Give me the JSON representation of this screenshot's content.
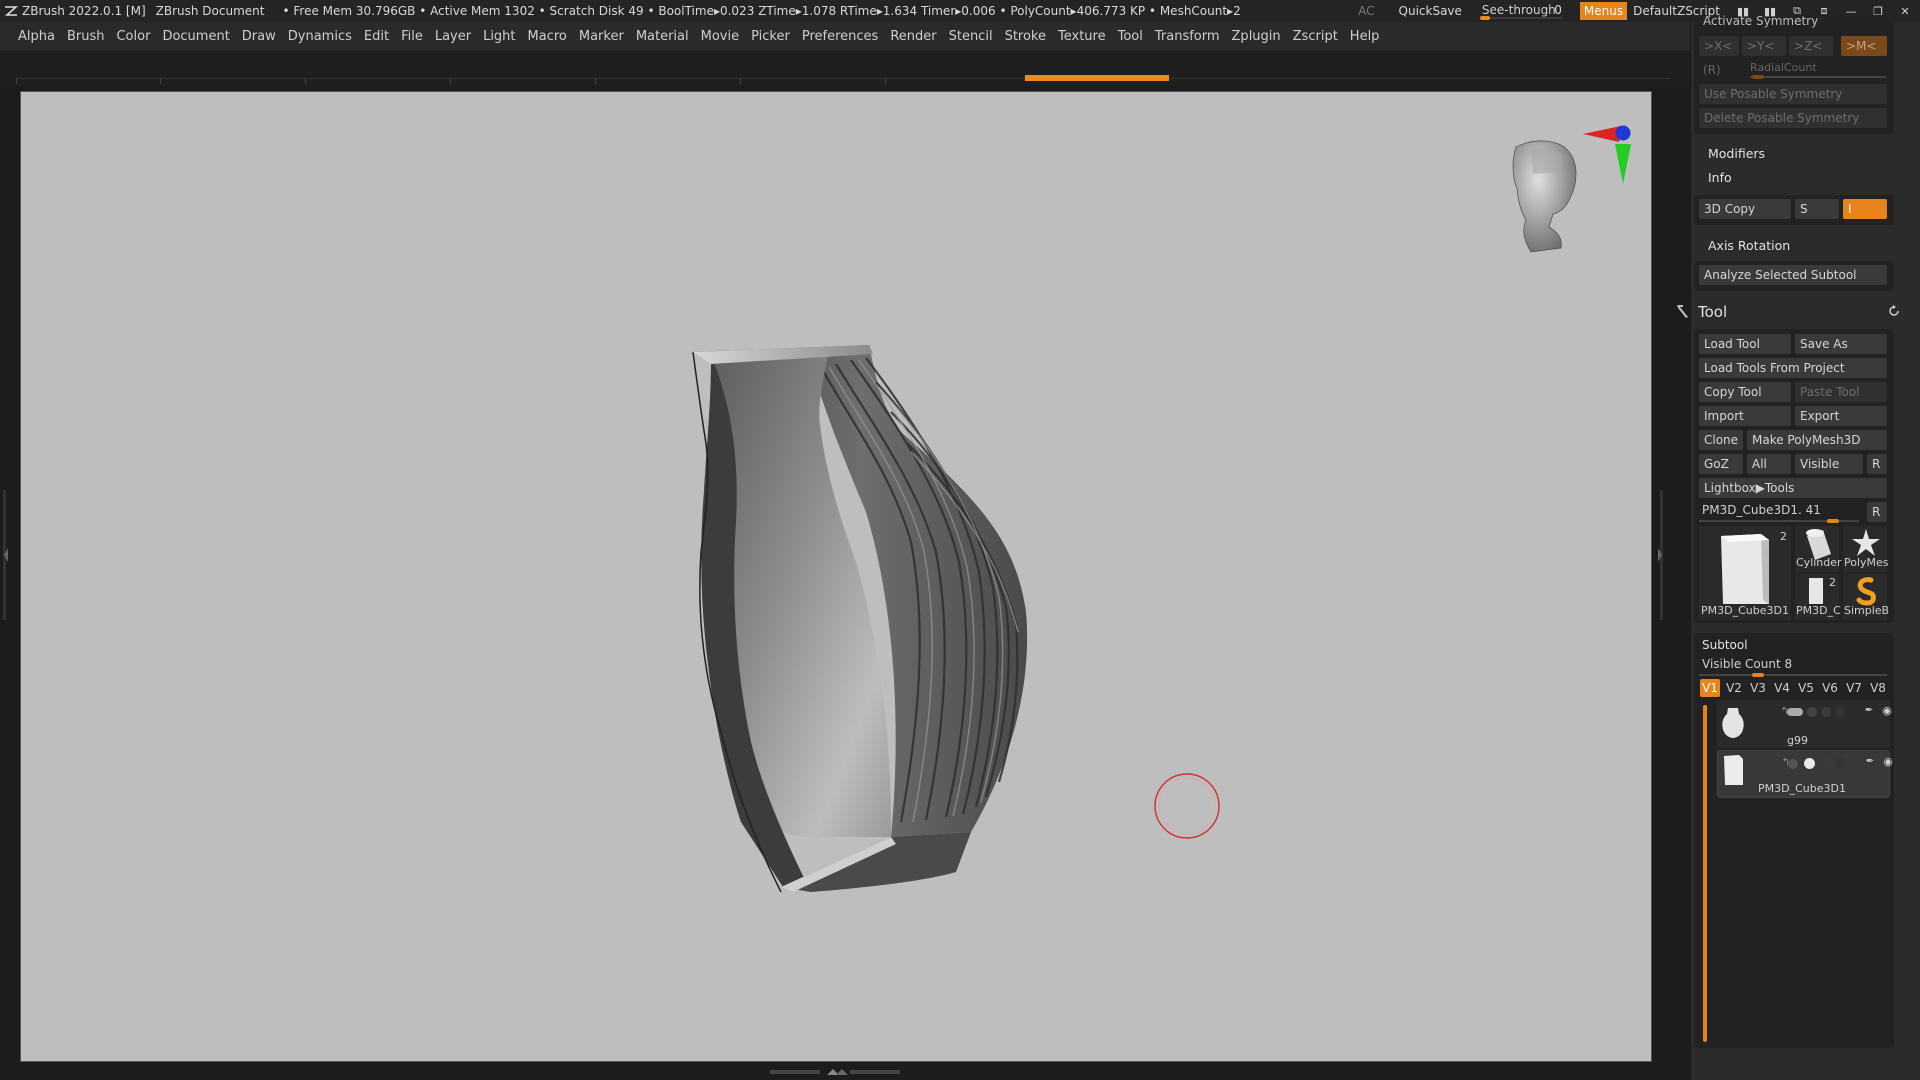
{
  "titlebar": {
    "app": "ZBrush 2022.0.1 [M]",
    "document": "ZBrush Document",
    "stats": "• Free Mem 30.796GB • Active Mem 1302 • Scratch Disk 49 •  BoolTime▸0.023 ZTime▸1.078 RTime▸1.634 Timer▸0.006 • PolyCount▸406.773 KP  • MeshCount▸2",
    "ac": "AC",
    "quicksave": "QuickSave",
    "see_through_label": "See-through",
    "see_through_value": "0",
    "menus": "Menus",
    "script": "DefaultZScript"
  },
  "menubar": [
    "Alpha",
    "Brush",
    "Color",
    "Document",
    "Draw",
    "Dynamics",
    "Edit",
    "File",
    "Layer",
    "Light",
    "Macro",
    "Marker",
    "Material",
    "Movie",
    "Picker",
    "Preferences",
    "Render",
    "Stencil",
    "Stroke",
    "Texture",
    "Tool",
    "Transform",
    "Zplugin",
    "Zscript",
    "Help"
  ],
  "symmetry": {
    "activate": "Activate Symmetry",
    "x": ">X<",
    "y": ">Y<",
    "z": ">Z<",
    "m": ">M<",
    "r": "(R)",
    "radial": "RadialCount",
    "use_posable": "Use Posable Symmetry",
    "delete_posable": "Delete Posable Symmetry"
  },
  "transform": {
    "modifiers": "Modifiers",
    "info": "Info",
    "copy3d": "3D Copy",
    "s": "S",
    "s_value": "I",
    "axis_rotation": "Axis Rotation",
    "analyze": "Analyze Selected Subtool"
  },
  "tool": {
    "title": "Tool",
    "load_tool": "Load Tool",
    "save_as": "Save As",
    "load_from_project": "Load Tools From Project",
    "copy_tool": "Copy Tool",
    "paste_tool": "Paste Tool",
    "import": "Import",
    "export": "Export",
    "clone": "Clone",
    "make_polymesh": "Make PolyMesh3D",
    "goz": "GoZ",
    "all": "All",
    "visible": "Visible",
    "r": "R",
    "lightbox": "Lightbox▶Tools",
    "current_tool": "PM3D_Cube3D1. 41",
    "thumbs": [
      {
        "label": "PM3D_Cube3D1",
        "badge": "2"
      },
      {
        "label": "Cylinder"
      },
      {
        "label": "PolyMes"
      },
      {
        "label": "PM3D_C",
        "badge": "2"
      },
      {
        "label": "SimpleB"
      }
    ]
  },
  "subtool": {
    "title": "Subtool",
    "visible_count_label": "Visible Count 8",
    "tabs": [
      "V1",
      "V2",
      "V3",
      "V4",
      "V5",
      "V6",
      "V7",
      "V8"
    ],
    "items": [
      {
        "name": "g99"
      },
      {
        "name": "PM3D_Cube3D1"
      }
    ]
  },
  "colors": {
    "accent": "#e8841c",
    "canvas": "#bebebe",
    "panel": "#2b2b2b"
  }
}
